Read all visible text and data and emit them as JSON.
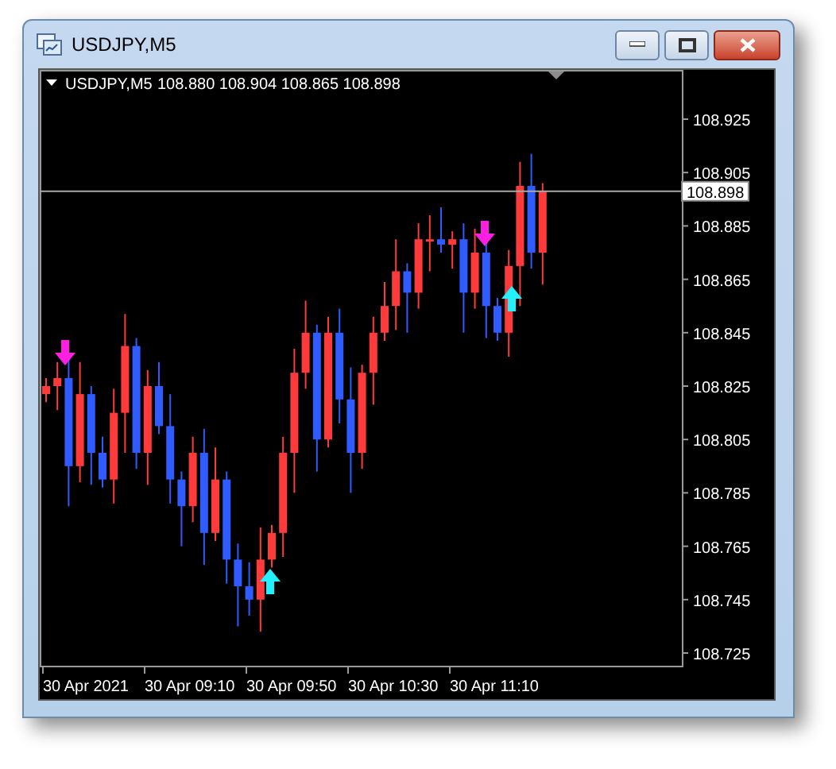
{
  "window": {
    "title": "USDJPY,M5"
  },
  "chart": {
    "symbol": "USDJPY,M5",
    "ohlc": "108.880 108.904 108.865 108.898",
    "current_price": "108.898",
    "price_axis": [
      "108.925",
      "108.905",
      "108.885",
      "108.865",
      "108.845",
      "108.825",
      "108.805",
      "108.785",
      "108.765",
      "108.745",
      "108.725"
    ],
    "time_axis": [
      "30 Apr 2021",
      "30 Apr 09:10",
      "30 Apr 09:50",
      "30 Apr 10:30",
      "30 Apr 11:10"
    ]
  }
}
